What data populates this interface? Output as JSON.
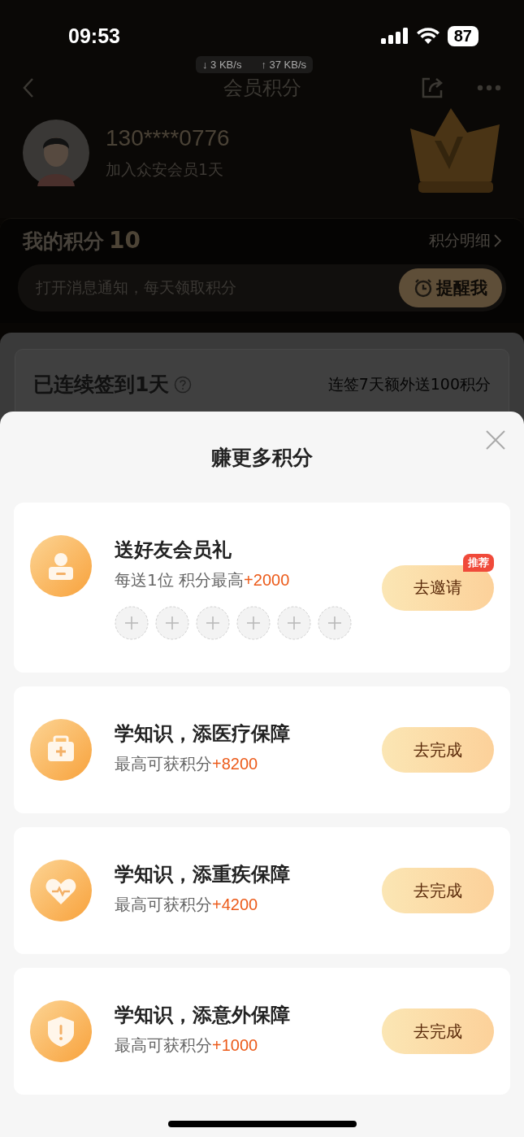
{
  "status_bar": {
    "time": "09:53",
    "battery": "87",
    "net_down": "↓ 3 KB/s",
    "net_up": "↑ 37 KB/s"
  },
  "nav": {
    "title": "会员积分"
  },
  "profile": {
    "phone": "130****0776",
    "member_days": "加入众安会员1天"
  },
  "points": {
    "label": "我的积分",
    "value": "10",
    "detail_link": "积分明细",
    "notice": "打开消息通知，每天领取积分",
    "remind_button": "提醒我"
  },
  "signin": {
    "title": "已连续签到1天",
    "hint": "连签7天额外送100积分"
  },
  "sheet": {
    "title": "赚更多积分",
    "tasks": [
      {
        "kind": "gift",
        "title": "送好友会员礼",
        "desc": "每送1位 积分最高",
        "bonus": "+2000",
        "button": "去邀请",
        "badge": "推荐",
        "invite_slots": [
          {
            "kind": "empty"
          },
          {
            "kind": "empty"
          },
          {
            "kind": "empty"
          },
          {
            "kind": "empty"
          },
          {
            "kind": "empty"
          },
          {
            "kind": "empty"
          }
        ]
      },
      {
        "kind": "medical",
        "title": "学知识，添医疗保障",
        "desc": "最高可获积分",
        "bonus": "+8200",
        "button": "去完成"
      },
      {
        "kind": "heart",
        "title": "学知识，添重疾保障",
        "desc": "最高可获积分",
        "bonus": "+4200",
        "button": "去完成"
      },
      {
        "kind": "shield",
        "title": "学知识，添意外保障",
        "desc": "最高可获积分",
        "bonus": "+1000",
        "button": "去完成"
      }
    ]
  }
}
